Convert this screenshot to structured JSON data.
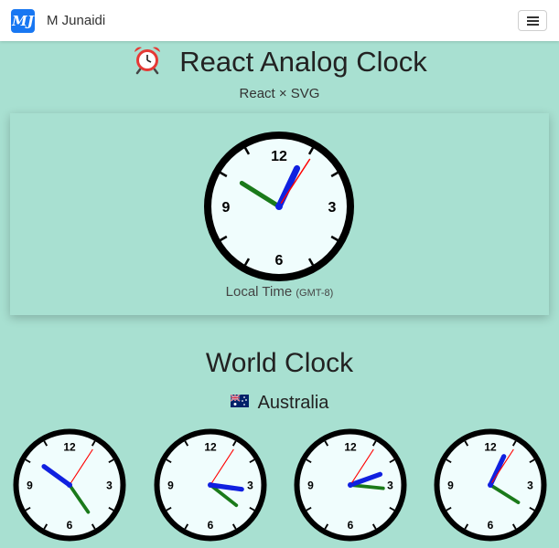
{
  "navbar": {
    "logo_text": "MJ",
    "brand_name": "M Junaidi",
    "menu_icon": "hamburger-icon"
  },
  "header": {
    "title_icon": "alarm-clock-icon",
    "title": "React Analog Clock",
    "subtitle": "React × SVG"
  },
  "local_clock": {
    "label": "Local Time",
    "gmt": "(GMT-8)",
    "time": {
      "hour": 10,
      "minute": 4.2,
      "second": 5.5
    }
  },
  "world": {
    "title": "World Clock",
    "country_flag": "australia-flag-icon",
    "country": "Australia",
    "clocks": [
      {
        "label": "",
        "time": {
          "hour": 4,
          "minute": 51,
          "second": 5.5
        }
      },
      {
        "label": "",
        "time": {
          "hour": 4,
          "minute": 16.3,
          "second": 5.5
        }
      },
      {
        "label": "",
        "time": {
          "hour": 3,
          "minute": 11.7,
          "second": 5.5
        }
      },
      {
        "label": "",
        "time": {
          "hour": 4,
          "minute": 4.2,
          "second": 5.5
        }
      }
    ]
  },
  "colors": {
    "background": "#a8e0d1",
    "clock_face": "#f0fdfd",
    "hour_hand": "#1a7a1a",
    "minute_hand": "#1020e0",
    "second_hand": "#ff0000",
    "brand": "#1877f2"
  }
}
